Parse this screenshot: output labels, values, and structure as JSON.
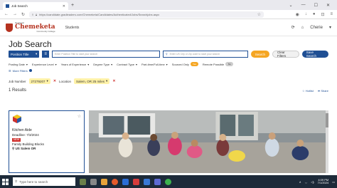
{
  "browser": {
    "tab_title": "Job Search",
    "url": "https://candidate.gradleaders.com/Chemeketa/Candidates/Authenticated/Jobs/Searchjobs.aspx"
  },
  "site": {
    "logo_top": "Ilmatsetal",
    "logo_name": "Chemeketa",
    "logo_sub": "Community College",
    "nav_students": "Students",
    "user_name": "Cherie"
  },
  "page": {
    "title": "Job Search"
  },
  "search": {
    "position_title": "Position Title",
    "keyword_placeholder": "Enter Position Title to start your search",
    "location_placeholder": "Enter US City or Zip code to start your search",
    "search_btn": "Search",
    "clear_btn": "Clear Filters",
    "save_btn": "Save Search"
  },
  "filters": {
    "posting_date": "Posting Date",
    "experience": "Experience Level",
    "years": "Years of Experience",
    "degree": "Degree Type",
    "contract": "Contract Type",
    "parttime": "Part-time/Full-time",
    "sourced_only": "Sourced Only",
    "sourced_toggle": "Yes",
    "remote": "Remote Possible",
    "remote_toggle": "No",
    "more_filters": "More Filters"
  },
  "chips": {
    "job_number_label": "Job Number",
    "job_number_value": "27279207",
    "location_label": "Location",
    "location_value": "Salem, OR 25 miles"
  },
  "results": {
    "count_text": "1 Results",
    "hotlist": "Hotlist",
    "share": "Share"
  },
  "job": {
    "title": "Kitchen Aide",
    "deadline": "Deadline: 7/3/2024",
    "badge": "NEW",
    "company": "Family Building Blocks",
    "location": "US Salem OR"
  },
  "taskbar": {
    "search_placeholder": "Type here to search",
    "time": "4:09 PM",
    "date": "7/1/2024"
  }
}
